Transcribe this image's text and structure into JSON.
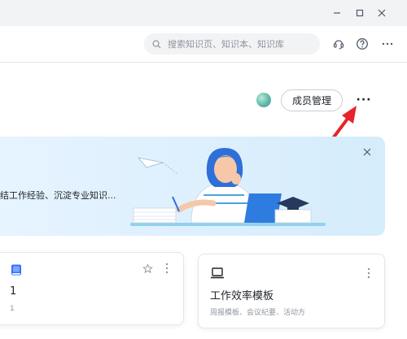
{
  "window": {
    "minimize_icon": "minimize-icon",
    "maximize_icon": "maximize-icon",
    "close_icon": "close-icon"
  },
  "toolbar": {
    "search_placeholder": "搜索知识页、知识本、知识库",
    "icons": [
      "support-icon",
      "help-icon",
      "more-icon"
    ]
  },
  "header": {
    "member_button": "成员管理",
    "more_label": "···"
  },
  "banner": {
    "text": "结工作经验、沉淀专业知识..."
  },
  "cards": [
    {
      "title": "1",
      "subtitle": "1",
      "icon": "book-icon",
      "icon_color": "#3370ff"
    },
    {
      "title": "工作效率模板",
      "subtitle": "周报模板、会议纪要、活动方",
      "icon": "laptop-icon"
    }
  ],
  "colors": {
    "accent": "#3370ff",
    "annotation_arrow": "#e8232b",
    "banner_bg": "#e3f2fd"
  }
}
